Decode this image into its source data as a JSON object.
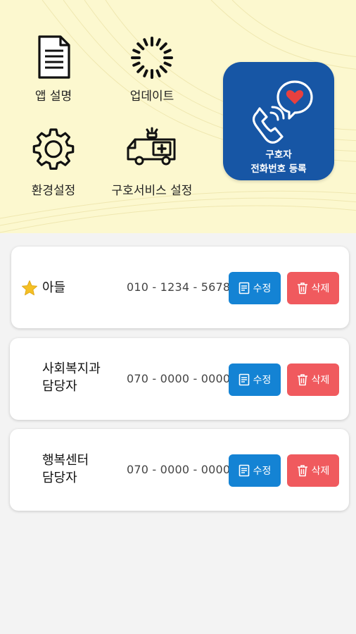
{
  "menu": {
    "app_description": "앱 설명",
    "update": "업데이트",
    "settings": "환경설정",
    "rescue_service_settings": "구호서비스 설정"
  },
  "register": {
    "line1": "구호자",
    "line2": "전화번호 등록"
  },
  "contacts": [
    {
      "name_line1": "아들",
      "name_line2": "",
      "phone": "010 - 1234 - 5678",
      "starred": true,
      "edit_label": "수정",
      "delete_label": "삭제"
    },
    {
      "name_line1": "사회복지과",
      "name_line2": "담당자",
      "phone": "070 - 0000 - 0000",
      "starred": false,
      "edit_label": "수정",
      "delete_label": "삭제"
    },
    {
      "name_line1": "행복센터",
      "name_line2": "담당자",
      "phone": "070 - 0000 - 0000",
      "starred": false,
      "edit_label": "수정",
      "delete_label": "삭제"
    }
  ],
  "colors": {
    "header_bg": "#fcf8cf",
    "register_bg": "#1756a5",
    "edit_button": "#1483d4",
    "delete_button": "#f05a5e",
    "star": "#f5c024",
    "heart": "#e8403f"
  }
}
